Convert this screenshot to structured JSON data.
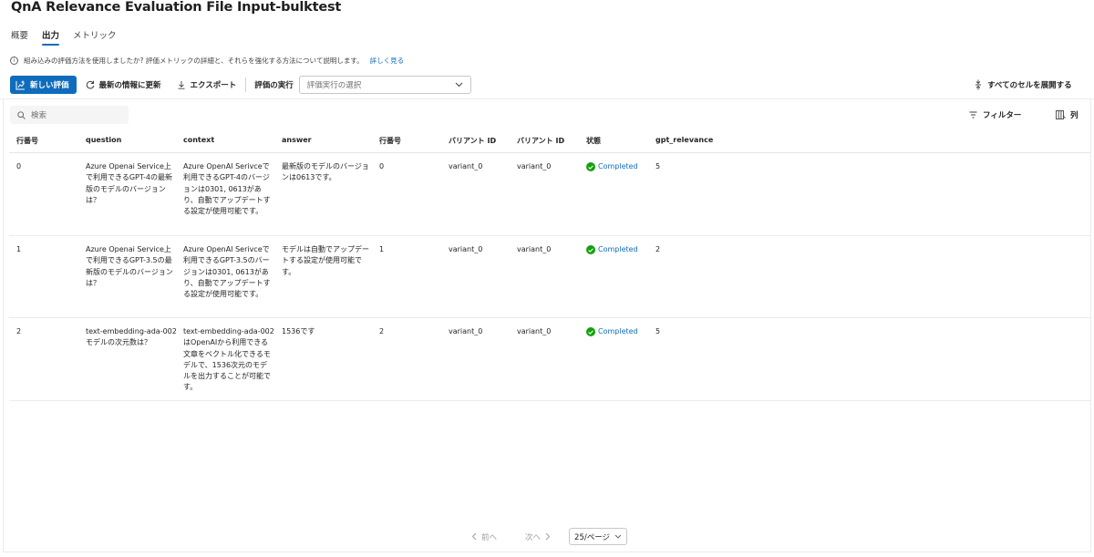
{
  "page": {
    "title": "QnA Relevance Evaluation File Input-bulktest"
  },
  "tabs": [
    {
      "label": "概要"
    },
    {
      "label": "出力"
    },
    {
      "label": "メトリック"
    }
  ],
  "info": {
    "icon": "info-icon",
    "text": "組み込みの評価方法を使用しましたか? 評価メトリックの詳細と、それらを強化する方法について説明します。",
    "link": "詳しく見る"
  },
  "toolbar": {
    "new_eval": "新しい評価",
    "refresh": "最新の情報に更新",
    "export": "エクスポート",
    "eval_run_label": "評価の実行",
    "eval_run_placeholder": "評価実行の選択",
    "expand_all": "すべてのセルを展開する"
  },
  "search": {
    "placeholder": "検索"
  },
  "filter_label": "フィルター",
  "columns_label": "列",
  "table": {
    "headers": [
      "行番号",
      "question",
      "context",
      "answer",
      "行番号",
      "バリアント ID",
      "バリアント ID",
      "状態",
      "gpt_relevance"
    ],
    "rows": [
      {
        "row": "0",
        "question": "Azure Openai Service上で利用できるGPT-4の最新版のモデルのバージョンは？",
        "context": "Azure OpenAI Serivceで利用できるGPT-4のバージョンは0301, 0613があり、自動でアップデートする設定が使用可能です。",
        "answer": "最新版のモデルのバージョンは0613です。",
        "line": "0",
        "variant1": "variant_0",
        "variant2": "variant_0",
        "status": "Completed",
        "relevance": "5"
      },
      {
        "row": "1",
        "question": "Azure Openai Service上で利用できるGPT-3.5の最新版のモデルのバージョンは？",
        "context": "Azure OpenAI Serivceで利用できるGPT-3.5のバージョンは0301, 0613があり、自動でアップデートする設定が使用可能です。",
        "answer": "モデルは自動でアップデートする設定が使用可能です。",
        "line": "1",
        "variant1": "variant_0",
        "variant2": "variant_0",
        "status": "Completed",
        "relevance": "2"
      },
      {
        "row": "2",
        "question": "text-embedding-ada-002モデルの次元数は？",
        "context": "text-embedding-ada-002はOpenAIから利用できる文章をベクトル化できるモデルで、1536次元のモデルを出力することが可能です。",
        "answer": "1536です",
        "line": "2",
        "variant1": "variant_0",
        "variant2": "variant_0",
        "status": "Completed",
        "relevance": "5"
      }
    ]
  },
  "pagination": {
    "prev": "前へ",
    "next": "次へ",
    "page_size": "25/ページ"
  },
  "colors": {
    "accent": "#0f6cbd",
    "success": "#13a10e"
  }
}
